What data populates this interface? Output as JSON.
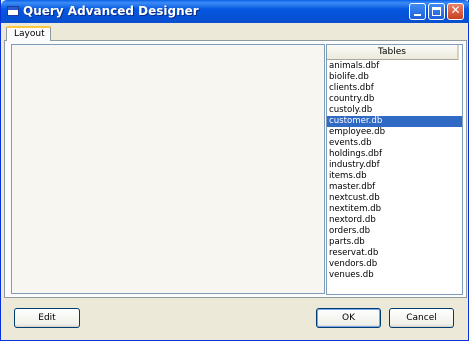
{
  "window": {
    "title": "Query Advanced Designer"
  },
  "tabs": [
    {
      "label": "Layout"
    }
  ],
  "tables_panel": {
    "header": "Tables",
    "selected": "customer.db",
    "items": [
      "animals.dbf",
      "biolife.db",
      "clients.dbf",
      "country.db",
      "custoly.db",
      "customer.db",
      "employee.db",
      "events.db",
      "holdings.dbf",
      "industry.dbf",
      "items.db",
      "master.dbf",
      "nextcust.db",
      "nextitem.db",
      "nextord.db",
      "orders.db",
      "parts.db",
      "reservat.db",
      "vendors.db",
      "venues.db"
    ]
  },
  "buttons": {
    "edit": "Edit",
    "ok": "OK",
    "cancel": "Cancel"
  }
}
